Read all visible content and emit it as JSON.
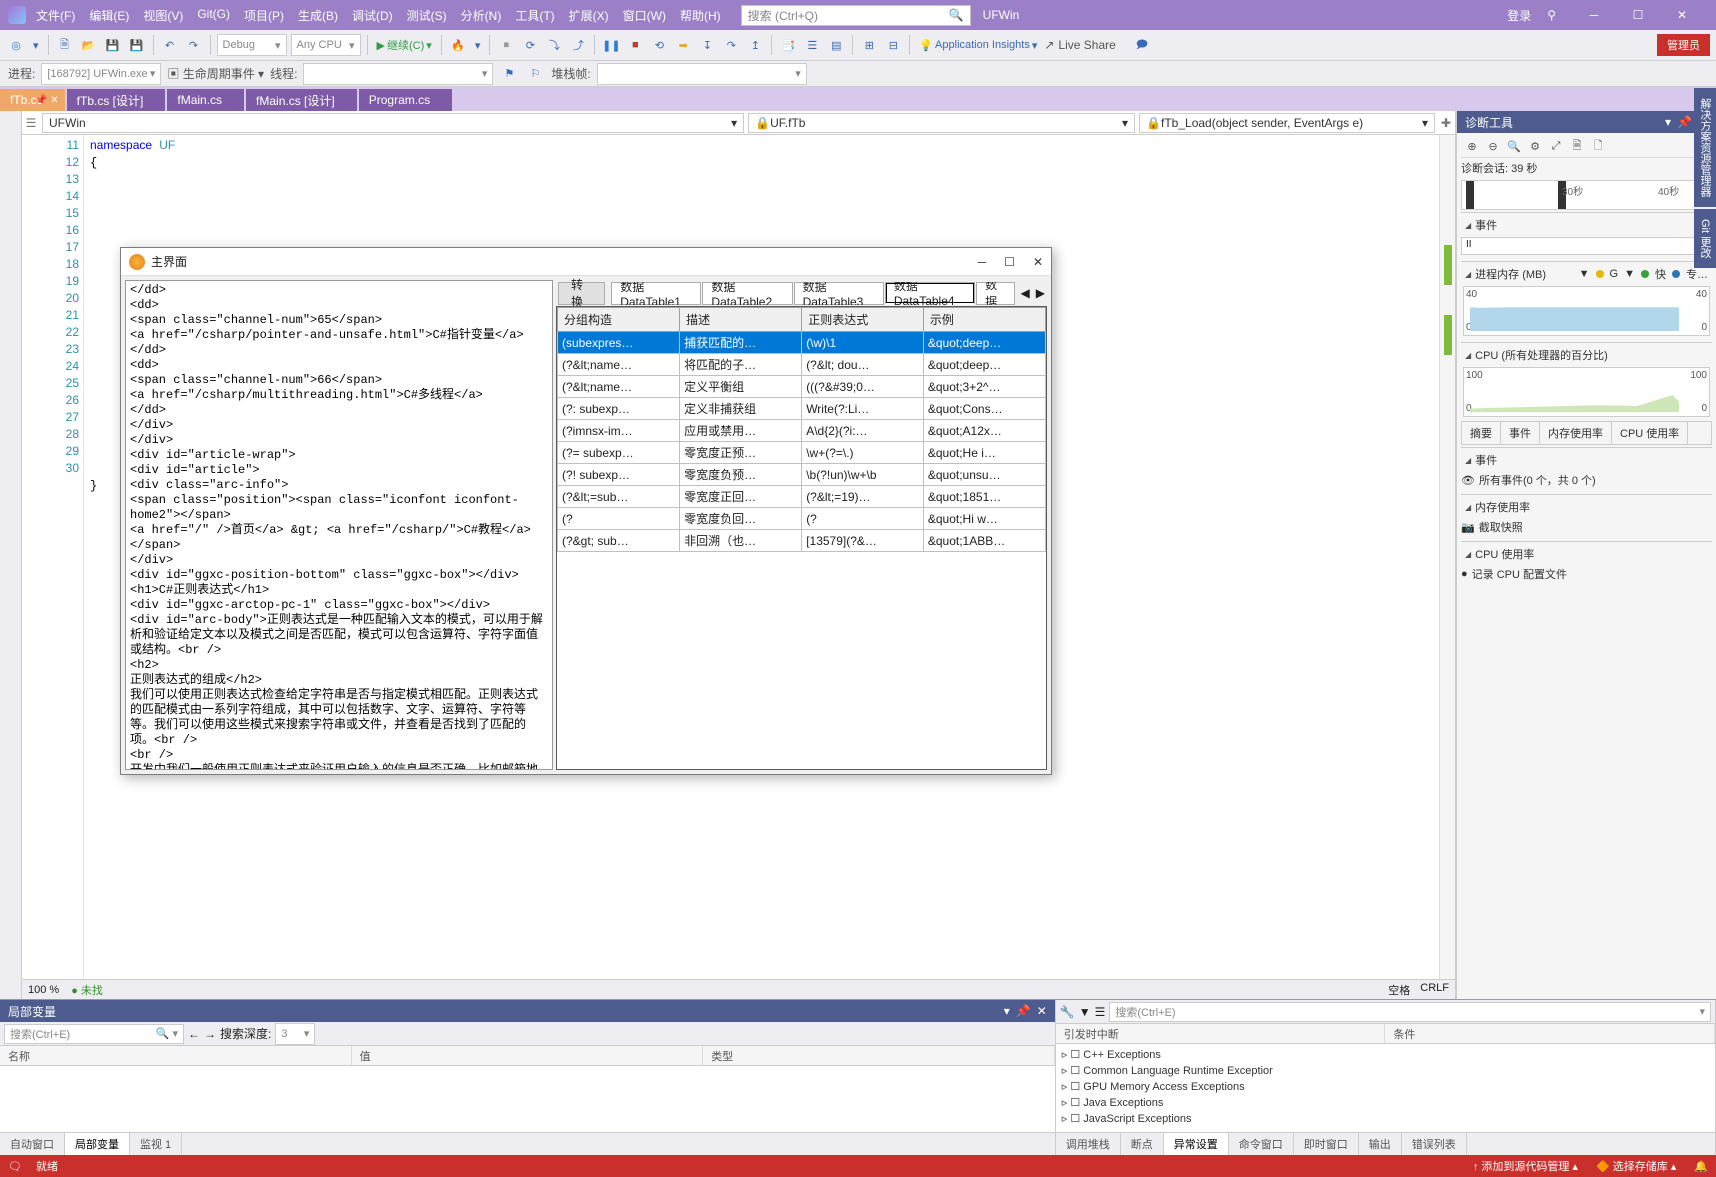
{
  "app": {
    "name": "UFWin",
    "login": "登录"
  },
  "menu": [
    "文件(F)",
    "编辑(E)",
    "视图(V)",
    "Git(G)",
    "项目(P)",
    "生成(B)",
    "调试(D)",
    "测试(S)",
    "分析(N)",
    "工具(T)",
    "扩展(X)",
    "窗口(W)",
    "帮助(H)"
  ],
  "searchPlaceholder": "搜索 (Ctrl+Q)",
  "toolbar": {
    "config": "Debug",
    "platform": "Any CPU",
    "continue": "继续(C)",
    "appinsights": "Application Insights",
    "liveshare": "Live Share",
    "admin": "管理员"
  },
  "debugRow": {
    "procLabel": "进程:",
    "proc": "[168792] UFWin.exe",
    "lifecycle": "生命周期事件",
    "threadLabel": "线程:",
    "stackframe": "堆栈帧:"
  },
  "docTabs": [
    "fTb.cs",
    "fTb.cs [设计]",
    "fMain.cs",
    "fMain.cs [设计]",
    "Program.cs"
  ],
  "nav": {
    "left": "UFWin",
    "right": "UF.fTb",
    "method": "fTb_Load(object sender, EventArgs e)"
  },
  "code": {
    "startLine": 11,
    "lines": [
      11,
      12,
      "",
      13,
      14,
      15,
      16,
      17,
      18,
      19,
      20,
      21,
      22,
      23,
      24,
      25,
      26,
      27,
      28,
      29,
      30
    ],
    "text": "namespace UF\n{\n"
  },
  "zoom": {
    "pct": "100 %",
    "status": "未找",
    "space": "空格",
    "crlf": "CRLF"
  },
  "floatwin": {
    "title": "主界面",
    "convert": "转换",
    "tabs": [
      "数据DataTable1",
      "数据DataTable2",
      "数据DataTable3",
      "数据DataTable4",
      "数据"
    ],
    "headers": [
      "分组构造",
      "描述",
      "正则表达式",
      "示例"
    ],
    "rows": [
      [
        "(subexpres…",
        "捕获匹配的…",
        "(\\w)\\1",
        "&quot;deep…"
      ],
      [
        "(?&lt;name…",
        "将匹配的子…",
        "(?&lt; dou…",
        "&quot;deep…"
      ],
      [
        "(?&lt;name…",
        "定义平衡组",
        "(((?&#39;0…",
        "&quot;3+2^…"
      ],
      [
        "(?: subexp…",
        "定义非捕获组",
        "Write(?:Li…",
        "&quot;Cons…"
      ],
      [
        "(?imnsx-im…",
        "应用或禁用…",
        "A\\d{2}(?i:…",
        "&quot;A12x…"
      ],
      [
        "(?= subexp…",
        "零宽度正预…",
        "\\w+(?=\\.)",
        "&quot;He i…"
      ],
      [
        "(?! subexp…",
        "零宽度负预…",
        "\\b(?!un)\\w+\\b",
        "&quot;unsu…"
      ],
      [
        "(?&lt;=sub…",
        "零宽度正回…",
        "(?&lt;=19)…",
        "&quot;1851…"
      ],
      [
        "(?",
        "零宽度负回…",
        "(?",
        "&quot;Hi w…"
      ],
      [
        "(?&gt; sub…",
        "非回溯（也…",
        "[13579](?&…",
        "&quot;1ABB…"
      ]
    ],
    "leftHtml": "</dd>\n<dd>\n<span class=\"channel-num\">65</span>\n<a href=\"/csharp/pointer-and-unsafe.html\">C#指针变量</a>\n</dd>\n<dd>\n<span class=\"channel-num\">66</span>\n<a href=\"/csharp/multithreading.html\">C#多线程</a>\n</dd>\n</div>\n</div>\n<div id=\"article-wrap\">\n<div id=\"article\">\n<div class=\"arc-info\">\n<span class=\"position\"><span class=\"iconfont iconfont-home2\"></span>\n<a href=\"/\" />首页</a> &gt; <a href=\"/csharp/\">C#教程</a></span>\n</div>\n<div id=\"ggxc-position-bottom\" class=\"ggxc-box\"></div>\n<h1>C#正则表达式</h1>\n<div id=\"ggxc-arctop-pc-1\" class=\"ggxc-box\"></div>\n<div id=\"arc-body\">正则表达式是一种匹配输入文本的模式，可以用于解析和验证给定文本以及模式之间是否匹配，模式可以包含运算符、字符字面值或结构。<br />\n<h2>\n正则表达式的组成</h2>\n我们可以使用正则表达式检查给定字符串是否与指定模式相匹配。正则表达式的匹配模式由一系列字符组成，其中可以包括数字、文字、运算符、字符等等。我们可以使用这些模式来搜索字符串或文件，并查看是否找到了匹配的项。<br />\n<br />\n开发中我们一般使用正则表达式来验证用户输入的信息是否正确，比如邮箱地址、手机号码等等。下面列举了用于定义正则表达式的各种类别的字符、运算符和结构：\n<ul>\n<li>\n转义字符；</li>\n<li>\n字符类；</li>\n<li>\n定位符；</li>\n<li>\n分组构造；</li>\n<li>\n限定符；</li>\n<li>\n反向引用构造；</li>\n<li>\n备用构造；</li>"
  },
  "diag": {
    "title": "诊断工具",
    "session": "诊断会话: 39 秒",
    "ticks": [
      "30秒",
      "40秒"
    ],
    "events": "事件",
    "pause": "II",
    "memTitle": "进程内存 (MB)",
    "memFlags": [
      "G",
      "快",
      "专…"
    ],
    "memY": "40",
    "memY0": "0",
    "cpuTitle": "CPU (所有处理器的百分比)",
    "cpuY": "100",
    "cpuY0": "0",
    "subtabs": [
      "摘要",
      "事件",
      "内存使用率",
      "CPU 使用率"
    ],
    "eventsHead": "事件",
    "eventsBody": "所有事件(0 个，共 0 个)",
    "memHead": "内存使用率",
    "memBody": "截取快照",
    "cpuHead": "CPU 使用率",
    "cpuBody": "记录 CPU 配置文件"
  },
  "sideTabs": [
    "解决方案资源管理器",
    "Git 更改"
  ],
  "bottomLeft": {
    "title": "局部变量",
    "search": "搜索(Ctrl+E)",
    "depthLabel": "搜索深度:",
    "depth": "3",
    "cols": [
      "名称",
      "值",
      "类型"
    ]
  },
  "bottomRight": {
    "search": "搜索(Ctrl+E)",
    "cols": [
      "引发时中断",
      "条件"
    ],
    "items": [
      "C++ Exceptions",
      "Common Language Runtime Exceptior",
      "GPU Memory Access Exceptions",
      "Java Exceptions",
      "JavaScript Exceptions"
    ]
  },
  "bottomTabsL": [
    "自动窗口",
    "局部变量",
    "监视 1"
  ],
  "bottomTabsR": [
    "调用堆栈",
    "断点",
    "异常设置",
    "命令窗口",
    "即时窗口",
    "输出",
    "错误列表"
  ],
  "status": {
    "ready": "就绪",
    "addgit": "添加到源代码管理",
    "repo": "选择存储库"
  },
  "chart_data": [
    {
      "type": "area",
      "title": "进程内存 (MB)",
      "x": [
        0,
        39
      ],
      "series": [
        {
          "name": "MB",
          "values": [
            28,
            28
          ]
        }
      ],
      "ylim": [
        0,
        40
      ]
    },
    {
      "type": "area",
      "title": "CPU (所有处理器的百分比)",
      "x": [
        0,
        39
      ],
      "series": [
        {
          "name": "CPU %",
          "values": [
            5,
            8,
            6,
            9,
            7,
            30,
            15
          ]
        }
      ],
      "ylim": [
        0,
        100
      ]
    }
  ]
}
